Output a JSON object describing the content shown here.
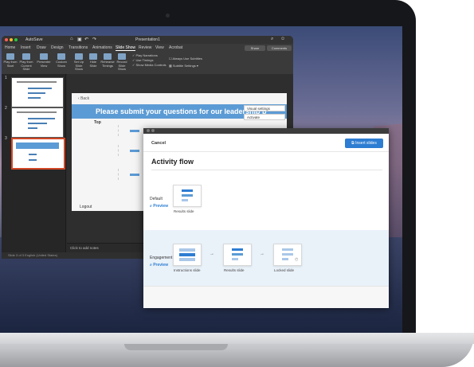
{
  "window": {
    "app_title": "Presentation1",
    "qat_label": "AutoSave"
  },
  "menu": [
    "Home",
    "Insert",
    "Draw",
    "Design",
    "Transitions",
    "Animations",
    "Slide Show",
    "Review",
    "View",
    "Acrobat"
  ],
  "active_menu": "Slide Show",
  "share_label": "Share",
  "comments_label": "Comments",
  "ribbon": {
    "buttons": [
      "Play from Start",
      "Play from Current Slide",
      "Presenter View",
      "Custom Show",
      "Set Up Slide Show",
      "Hide Slide",
      "Rehearse Timings",
      "Record Slide Show"
    ],
    "checks": [
      "Play Narrations",
      "Use Timings",
      "Show Media Controls"
    ],
    "always_subtitles": "Always Use Subtitles",
    "subtitle_settings": "Subtitle Settings"
  },
  "thumbnails": {
    "numbers": [
      "1",
      "2",
      "3"
    ]
  },
  "slide": {
    "back": "Back",
    "title": "Please submit your questions for our leadership p",
    "top_label": "Top",
    "logout": "Logout",
    "visual_settings": "Visual settings",
    "activate": "Activate"
  },
  "notes_placeholder": "Click to add notes",
  "status": "Slide 3 of 3   English (United States)",
  "dialog": {
    "cancel": "Cancel",
    "insert": "Insert slides",
    "title": "Activity flow",
    "default_label": "Default",
    "preview": "Preview",
    "default_cards": [
      "Results slide"
    ],
    "engagement_label": "Engagement",
    "engagement_cards": [
      "Instructions slide",
      "Results slide",
      "Locked slide"
    ]
  },
  "colors": {
    "accent": "#2d7dd2",
    "slide_header": "#5b9bd5",
    "thumb_selected": "#d24726"
  }
}
